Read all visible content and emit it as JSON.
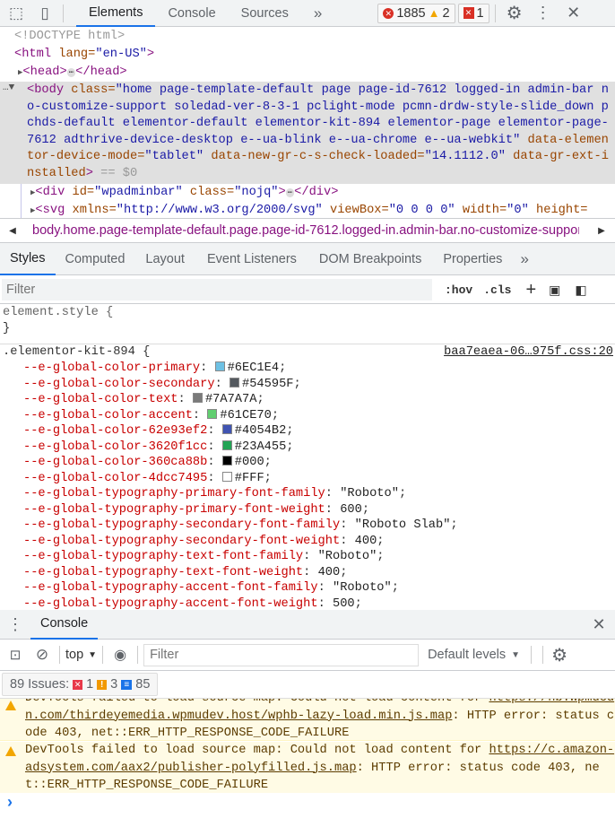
{
  "toolbar": {
    "tabs": [
      "Elements",
      "Console",
      "Sources"
    ],
    "more": "»",
    "errors": "1885",
    "warnings": "2",
    "issues": "1"
  },
  "tree": {
    "doctype": "<!DOCTYPE html>",
    "html_open": "<html",
    "html_attr": " lang=",
    "html_val": "\"en-US\"",
    "html_close": ">",
    "head": "<head>",
    "head_end": "</head>",
    "body_tag": "<body",
    "body_class_attr": " class=",
    "body_class_val": "\"home page-template-default page page-id-7612 logged-in admin-bar no-customize-support soledad-ver-8-3-1 pclight-mode pcmn-drdw-style-slide_down pchds-default elementor-default elementor-kit-894 elementor-page elementor-page-7612 adthrive-device-desktop e--ua-blink e--ua-chrome e--ua-webkit\"",
    "body_attr2": " data-elementor-device-mode=",
    "body_val2": "\"tablet\"",
    "body_attr3": " data-new-gr-c-s-check-loaded=",
    "body_val3": "\"14.1112.0\"",
    "body_attr4": " data-gr-ext-installed",
    "body_end": ">",
    "body_eq": " == $0",
    "div_tag": "<div",
    "div_id": " id=",
    "div_id_val": "\"wpadminbar\"",
    "div_class": " class=",
    "div_class_val": "\"nojq\"",
    "div_close": ">",
    "div_end": "</div>",
    "svg_tag": "<svg",
    "svg_attrs": " xmlns=",
    "svg_val": "\"http://www.w3.org/2000/svg\"",
    "svg_vb": " viewBox=",
    "svg_vb_val": "\"0 0 0 0\"",
    "svg_w": " width=",
    "svg_w_val": "\"0\"",
    "svg_h": " height="
  },
  "breadcrumb": "body.home.page-template-default.page.page-id-7612.logged-in.admin-bar.no-customize-support",
  "styles_tabs": [
    "Styles",
    "Computed",
    "Layout",
    "Event Listeners",
    "DOM Breakpoints",
    "Properties"
  ],
  "filter": {
    "placeholder": "Filter",
    "hov": ":hov",
    "cls": ".cls"
  },
  "element_style": {
    "selector": "element.style {",
    "close": "}"
  },
  "rule": {
    "selector": ".elementor-kit-894 {",
    "source": "baa7eaea-06…975f.css:20",
    "props": [
      {
        "name": "--e-global-color-primary",
        "value": "#6EC1E4",
        "swatch": "#6EC1E4"
      },
      {
        "name": "--e-global-color-secondary",
        "value": "#54595F",
        "swatch": "#54595F"
      },
      {
        "name": "--e-global-color-text",
        "value": "#7A7A7A",
        "swatch": "#7A7A7A"
      },
      {
        "name": "--e-global-color-accent",
        "value": "#61CE70",
        "swatch": "#61CE70"
      },
      {
        "name": "--e-global-color-62e93ef2",
        "value": "#4054B2",
        "swatch": "#4054B2"
      },
      {
        "name": "--e-global-color-3620f1cc",
        "value": "#23A455",
        "swatch": "#23A455"
      },
      {
        "name": "--e-global-color-360ca88b",
        "value": "#000",
        "swatch": "#000000"
      },
      {
        "name": "--e-global-color-4dcc7495",
        "value": "#FFF",
        "swatch": "#FFFFFF"
      },
      {
        "name": "--e-global-typography-primary-font-family",
        "value": "\"Roboto\""
      },
      {
        "name": "--e-global-typography-primary-font-weight",
        "value": "600"
      },
      {
        "name": "--e-global-typography-secondary-font-family",
        "value": "\"Roboto Slab\""
      },
      {
        "name": "--e-global-typography-secondary-font-weight",
        "value": "400"
      },
      {
        "name": "--e-global-typography-text-font-family",
        "value": "\"Roboto\""
      },
      {
        "name": "--e-global-typography-text-font-weight",
        "value": "400"
      },
      {
        "name": "--e-global-typography-accent-font-family",
        "value": "\"Roboto\""
      },
      {
        "name": "--e-global-typography-accent-font-weight",
        "value": "500"
      }
    ]
  },
  "drawer": {
    "tab": "Console"
  },
  "console": {
    "context": "top",
    "filter_placeholder": "Filter",
    "levels": "Default levels",
    "issues_label": "89 Issues:",
    "issues_err": "1",
    "issues_warn": "3",
    "issues_info": "85",
    "messages": [
      {
        "pre": "DevTools failed to load source map: Could not load content for ",
        "link": "https://hb.wpmucdn.com/thirdeyemedia.wpmudev.host/wphb-lazy-load.min.js.map",
        "post": ": HTTP error: status code 403, net::ERR_HTTP_RESPONSE_CODE_FAILURE"
      },
      {
        "pre": "DevTools failed to load source map: Could not load content for ",
        "link": "https://c.amazon-adsystem.com/aax2/publisher-polyfilled.js.map",
        "post": ": HTTP error: status code 403, net::ERR_HTTP_RESPONSE_CODE_FAILURE"
      }
    ],
    "prompt": "›"
  }
}
